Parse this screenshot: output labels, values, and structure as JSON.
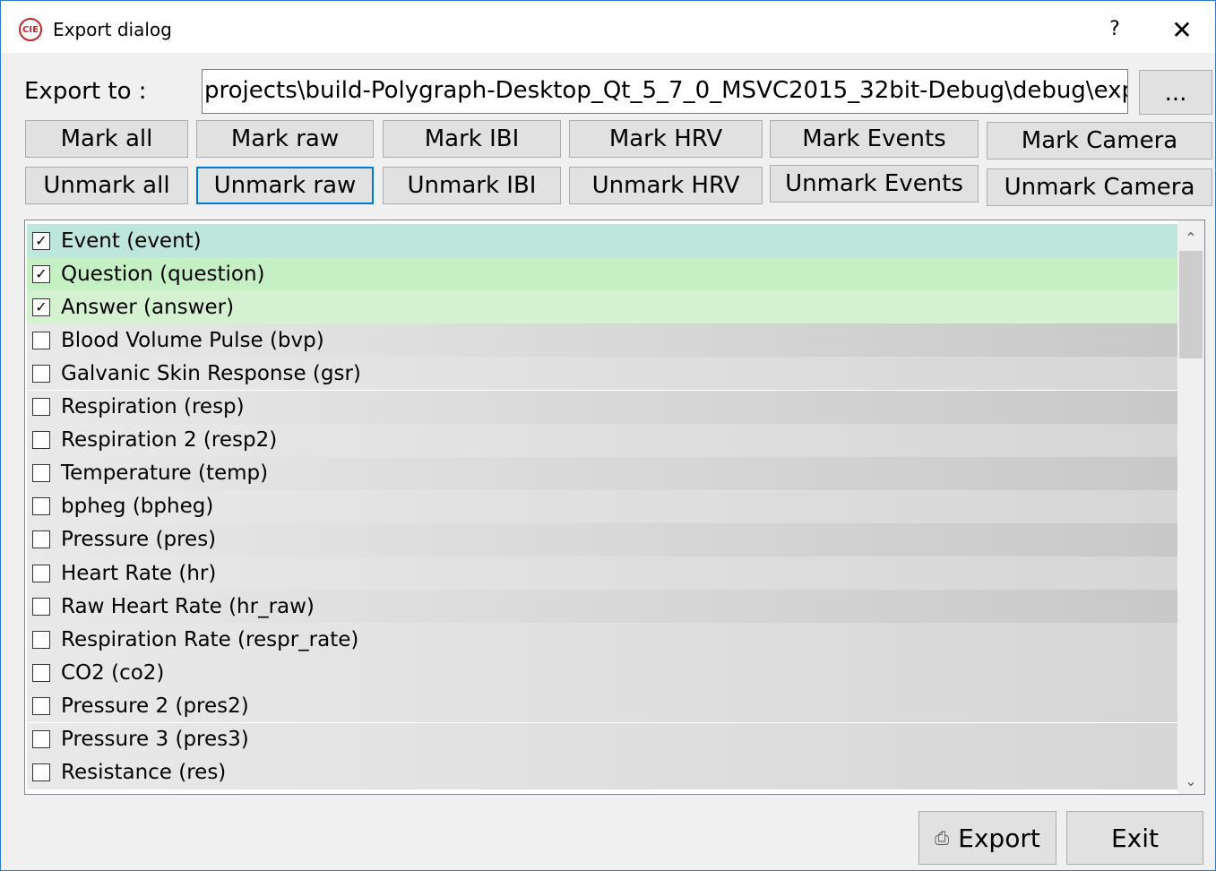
{
  "window": {
    "title": "Export dialog",
    "app_icon_text": "CIE",
    "help": "?",
    "close": "✕"
  },
  "export_to": {
    "label": "Export to :",
    "path": "projects\\build-Polygraph-Desktop_Qt_5_7_0_MSVC2015_32bit-Debug\\debug\\export\\",
    "browse_label": "..."
  },
  "mark_buttons": [
    "Mark all",
    "Mark raw",
    "Mark IBI",
    "Mark HRV",
    "Mark Events",
    "Mark Camera"
  ],
  "unmark_buttons": [
    "Unmark all",
    "Unmark raw",
    "Unmark IBI",
    "Unmark HRV",
    "Unmark Events",
    "Unmark Camera"
  ],
  "channels": [
    {
      "label": "Event (event)",
      "checked": true,
      "color": "#bfe6dc"
    },
    {
      "label": "Question (question)",
      "checked": true,
      "color": "#c4f0c4"
    },
    {
      "label": "Answer (answer)",
      "checked": true,
      "color": "#d4f2d0"
    },
    {
      "label": "Blood Volume Pulse (bvp)",
      "checked": false,
      "color": "#c8c8c8"
    },
    {
      "label": "Galvanic Skin Response (gsr)",
      "checked": false,
      "color": "#d6d6d6"
    },
    {
      "label": "Respiration (resp)",
      "checked": false,
      "color": "#c8c8c8"
    },
    {
      "label": "Respiration 2 (resp2)",
      "checked": false,
      "color": "#d6d6d6"
    },
    {
      "label": "Temperature (temp)",
      "checked": false,
      "color": "#c8c8c8"
    },
    {
      "label": "bpheg (bpheg)",
      "checked": false,
      "color": "#d6d6d6"
    },
    {
      "label": "Pressure (pres)",
      "checked": false,
      "color": "#c8c8c8"
    },
    {
      "label": "Heart Rate (hr)",
      "checked": false,
      "color": "#d6d6d6"
    },
    {
      "label": "Raw Heart Rate (hr_raw)",
      "checked": false,
      "color": "#c8c8c8"
    },
    {
      "label": "Respiration Rate (respr_rate)",
      "checked": false,
      "color": "#d6d6d6"
    },
    {
      "label": "CO2 (co2)",
      "checked": false,
      "color": "#d6d6d6"
    },
    {
      "label": "Pressure 2 (pres2)",
      "checked": false,
      "color": "#d6d6d6"
    },
    {
      "label": "Pressure 3 (pres3)",
      "checked": false,
      "color": "#d6d6d6"
    },
    {
      "label": "Resistance (res)",
      "checked": false,
      "color": "#d6d6d6"
    }
  ],
  "footer": {
    "export_label": "Export",
    "export_icon": "export-icon",
    "exit_label": "Exit"
  }
}
